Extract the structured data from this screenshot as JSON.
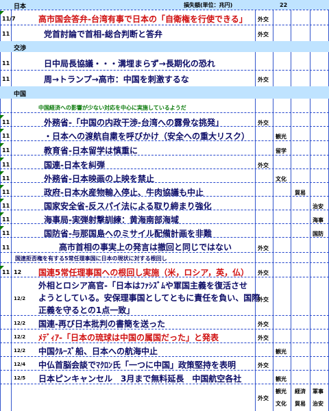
{
  "header": {
    "section": "日本",
    "unit": "損失額(単位：兆円)",
    "num": "22"
  },
  "rows": [
    {
      "date": "11/7",
      "text": "高市国会答弁-台湾有事で日本の「自衛権を行使できる」",
      "cat": "外交",
      "style": "red"
    },
    {
      "date": "11",
      "text": "党首討論で首相-総合判断と答弁",
      "cat": "外交",
      "style": "dark"
    },
    {
      "section": "交渉"
    },
    {
      "date": "11",
      "text": "日中局長協議・・・溝埋まらず→長期化の恐れ",
      "cat": "",
      "style": "dark"
    },
    {
      "date": "11",
      "text": "周→トランプ→高市：中国を刺激するな",
      "cat": "外交",
      "style": "dark"
    },
    {
      "section": "中国"
    },
    {
      "note_green": "中国経済への影響が少ない対応を中心に実施しているようだ"
    },
    {
      "date": "11",
      "text": "外務省-「中国の内政干渉-台湾への露骨な挑発」",
      "cat": "外交",
      "style": "dark"
    },
    {
      "date": "11",
      "text": "・日本への渡航自粛を呼びかけ（安全への重大リスク）",
      "cat": "",
      "tag": "観光",
      "style": "dark"
    },
    {
      "date": "11",
      "text": "教育省-日本留学は慎重に",
      "cat": "",
      "tag": "留学",
      "style": "dark"
    },
    {
      "date": "11",
      "text": "国連-日本を糾弾",
      "cat": "外交",
      "style": "dark"
    },
    {
      "date": "11",
      "text": "外務省-日本映画の上映を禁止",
      "cat": "",
      "tag": "文化",
      "style": "dark"
    },
    {
      "date": "11",
      "text": "政府-日本水産物輸入停止、牛肉協議も中止",
      "cat": "",
      "tag2": "貿易",
      "style": "dark"
    },
    {
      "date": "11",
      "text": "国家安全省-反スパイ法による取り締まり強化",
      "cat": "",
      "tag3": "治安",
      "style": "dark"
    },
    {
      "date": "11",
      "text": "海事局-実弾射撃訓練：黄海南部海域",
      "cat": "",
      "tag3": "海事",
      "style": "dark"
    },
    {
      "date": "11",
      "text": "国防省-与那国島へのミサイル配備計画を非難",
      "cat": "",
      "tag3": "国防",
      "style": "dark"
    },
    {
      "date": "11",
      "text": "高市首相の事実上の発言は撤回と同じではない",
      "cat": "外交",
      "style": "dark"
    },
    {
      "note_blue": "国連拒否権を有する5常任理事国に日本の現状に対する根回し"
    },
    {
      "date": "11",
      "date2": "12",
      "text": "国連5常任理事国への根回し実施（米，ロシア，英，仏）",
      "cat": "外交",
      "style": "red"
    },
    {
      "date2": "12/2",
      "lines": [
        "外相とロシア高官-「日本はﾌｧｼｽﾞﾑや軍国主義を復活させ",
        "ようとしている。安保理事国としてともに責任を負い、国際",
        "正義を守るとの1点一致」"
      ],
      "cat": "外交",
      "style": "dark"
    },
    {
      "date2": "12/2",
      "text": "国連-再び日本批判の書簡を送った",
      "cat": "外交",
      "style": "dark"
    },
    {
      "date2": "12/2",
      "text": "ﾒﾃﾞｨｱ-「日本の琉球は中国の属国だった」と発表",
      "cat": "外交",
      "style": "red"
    },
    {
      "date2": "12/2",
      "text": "中国ｸﾙｰｽﾞ船、日本への航海中止",
      "cat": "",
      "tag": "観光",
      "style": "dark"
    },
    {
      "date2": "12/4",
      "text": "中仏首脳会談でﾏｸﾛﾝ氏「一つに中国」政策堅持を表明",
      "cat": "外交",
      "style": "dark"
    },
    {
      "date2": "12/5",
      "text": "日本ピンキャンセル　3月まで無料延長　中国航空各社",
      "cat": "",
      "tag": "観光",
      "style": "dark"
    }
  ],
  "footer": {
    "c1": "外交",
    "c2a": "観光",
    "c2b": "文化",
    "c3a": "経済",
    "c3b": "貿易",
    "c4a": "軍事",
    "c4b": "治安"
  }
}
